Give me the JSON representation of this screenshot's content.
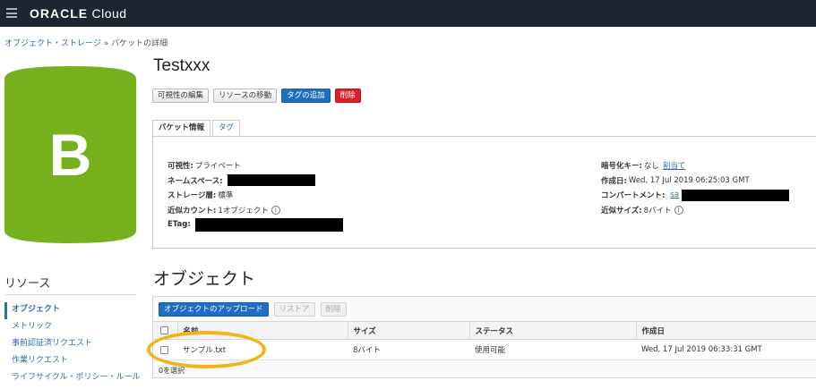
{
  "topbar": {
    "brand_bold": "ORACLE",
    "brand_light": " Cloud"
  },
  "breadcrumb": {
    "link": "オブジェクト・ストレージ",
    "separator": " » ",
    "current": "バケットの詳細"
  },
  "bucket": {
    "badge_letter": "B",
    "badge_color": "#76b01c",
    "name": "Testxxx"
  },
  "actions": {
    "edit_visibility": "可視性の編集",
    "move_resource": "リソースの移動",
    "add_tags": "タグの追加",
    "delete": "削除"
  },
  "tabs": [
    {
      "label": "バケット情報",
      "active": true
    },
    {
      "label": "タグ",
      "active": false
    }
  ],
  "bucket_info": {
    "visibility_label": "可視性:",
    "visibility_value": "プライベート",
    "namespace_label": "ネームスペース:",
    "storage_tier_label": "ストレージ層:",
    "storage_tier_value": "標準",
    "approx_count_label": "近似カウント:",
    "approx_count_value": "1オブジェクト",
    "etag_label": "ETag:",
    "encryption_label": "暗号化キー:",
    "encryption_value": "なし",
    "encryption_link": "割当て",
    "created_label": "作成日:",
    "created_value": "Wed, 17 Jul 2019 06:25:03 GMT",
    "compartment_label": "コンパートメント:",
    "compartment_link": "sa",
    "approx_size_label": "近似サイズ:",
    "approx_size_value": "8バイト"
  },
  "resources": {
    "title": "リソース",
    "items": [
      {
        "label": "オブジェクト",
        "active": true
      },
      {
        "label": "メトリック",
        "active": false
      },
      {
        "label": "事前認証済リクエスト",
        "active": false
      },
      {
        "label": "作業リクエスト",
        "active": false
      },
      {
        "label": "ライフサイクル・ポリシー・ルール",
        "active": false
      }
    ]
  },
  "objects": {
    "title": "オブジェクト",
    "upload_button": "オブジェクトのアップロード",
    "restore_button": "リストア",
    "delete_button": "削除",
    "columns": [
      "名前",
      "サイズ",
      "ステータス",
      "作成日"
    ],
    "rows": [
      {
        "name": "サンプル.txt",
        "size": "8バイト",
        "status": "使用可能",
        "created": "Wed, 17 Jul 2019 06:33:31 GMT"
      }
    ],
    "footer": "0を選択"
  },
  "colors": {
    "topbar": "#1c2530",
    "link": "#2f6db3",
    "primary": "#1e6fc4",
    "danger": "#dd1d29",
    "highlight": "#f2b31c"
  }
}
